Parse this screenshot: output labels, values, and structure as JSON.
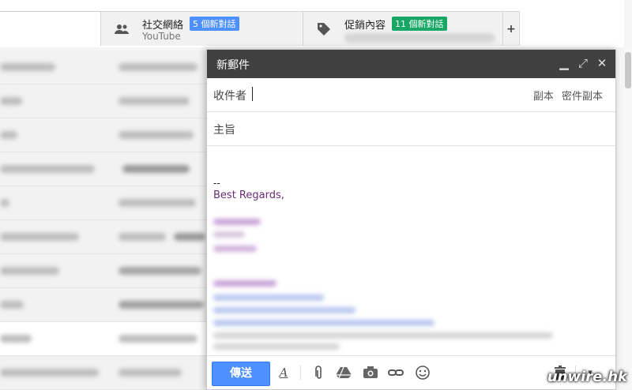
{
  "tabs": {
    "social": {
      "name": "社交網絡",
      "badge": "5 個新對話",
      "sub": "YouTube"
    },
    "promotions": {
      "name": "促銷內容",
      "badge": "11 個新對話"
    },
    "add": "+"
  },
  "compose": {
    "title": "新郵件",
    "to_label": "收件者",
    "cc_label": "副本",
    "bcc_label": "密件副本",
    "subject_label": "主旨",
    "signature_dash": "--",
    "signature_regards": "Best Regards,",
    "send_label": "傳送"
  },
  "watermark": "unwire.hk",
  "colors": {
    "send": "#4d90fe",
    "social_badge": "#4d90fe",
    "promo_badge": "#16a765",
    "header": "#404040"
  }
}
